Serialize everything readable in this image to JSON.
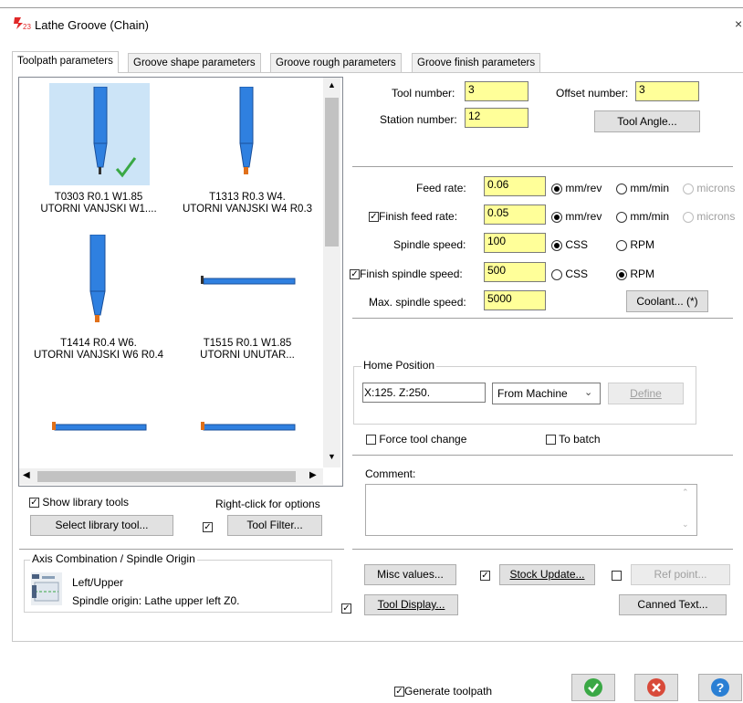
{
  "window": {
    "title": "Lathe Groove (Chain)",
    "close_glyph": "×"
  },
  "tabs": [
    {
      "label": "Toolpath parameters"
    },
    {
      "label": "Groove shape parameters"
    },
    {
      "label": "Groove rough parameters"
    },
    {
      "label": "Groove finish parameters"
    }
  ],
  "tools": [
    {
      "line1": "T0303 R0.1 W1.85",
      "line2": "UTORNI VANJSKI W1....",
      "selected": true
    },
    {
      "line1": "T1313 R0.3 W4.",
      "line2": "UTORNI VANJSKI W4 R0.3"
    },
    {
      "line1": "T1414 R0.4 W6.",
      "line2": "UTORNI VANJSKI W6 R0.4"
    },
    {
      "line1": "T1515 R0.1 W1.85",
      "line2": "UTORNI UNUTAR..."
    }
  ],
  "library": {
    "show_library_tools": "Show library tools",
    "right_click_hint": "Right-click for options",
    "select_library_tool": "Select library tool...",
    "tool_filter": "Tool Filter...",
    "tool_filter_checked": true,
    "show_library_checked": true
  },
  "tool_fields": {
    "tool_number_label": "Tool number:",
    "tool_number": "3",
    "offset_number_label": "Offset number:",
    "offset_number": "3",
    "station_number_label": "Station number:",
    "station_number": "12",
    "tool_angle": "Tool Angle..."
  },
  "feeds": {
    "feed_rate_label": "Feed rate:",
    "feed_rate": "0.06",
    "finish_feed_label": "Finish feed rate:",
    "finish_feed": "0.05",
    "spindle_speed_label": "Spindle speed:",
    "spindle_speed": "100",
    "finish_spindle_label": "Finish spindle speed:",
    "finish_spindle": "500",
    "max_spindle_label": "Max. spindle speed:",
    "max_spindle": "5000",
    "mm_rev": "mm/rev",
    "mm_min": "mm/min",
    "microns": "microns",
    "css": "CSS",
    "rpm": "RPM",
    "coolant": "Coolant... (*)"
  },
  "home": {
    "title": "Home Position",
    "value": "X:125.  Z:250.",
    "mode": "From Machine",
    "define": "Define"
  },
  "options": {
    "force_tool_change": "Force tool change",
    "to_batch": "To batch",
    "comment_label": "Comment:"
  },
  "axis": {
    "title": "Axis Combination / Spindle Origin",
    "combo": "Left/Upper",
    "origin": "Spindle origin: Lathe upper left   Z0."
  },
  "buttons": {
    "misc_values": "Misc values...",
    "stock_update": "Stock Update...",
    "ref_point": "Ref point...",
    "tool_display": "Tool Display...",
    "canned_text": "Canned Text...",
    "generate_toolpath": "Generate toolpath"
  },
  "colors": {
    "tool_blue": "#2f80e0",
    "insert_orange": "#e0701a",
    "ok_green": "#3aa845",
    "cancel_red": "#d84a3a",
    "help_blue": "#2a7fd4",
    "highlight": "#cce4f7",
    "field_yellow": "#ffff99"
  }
}
